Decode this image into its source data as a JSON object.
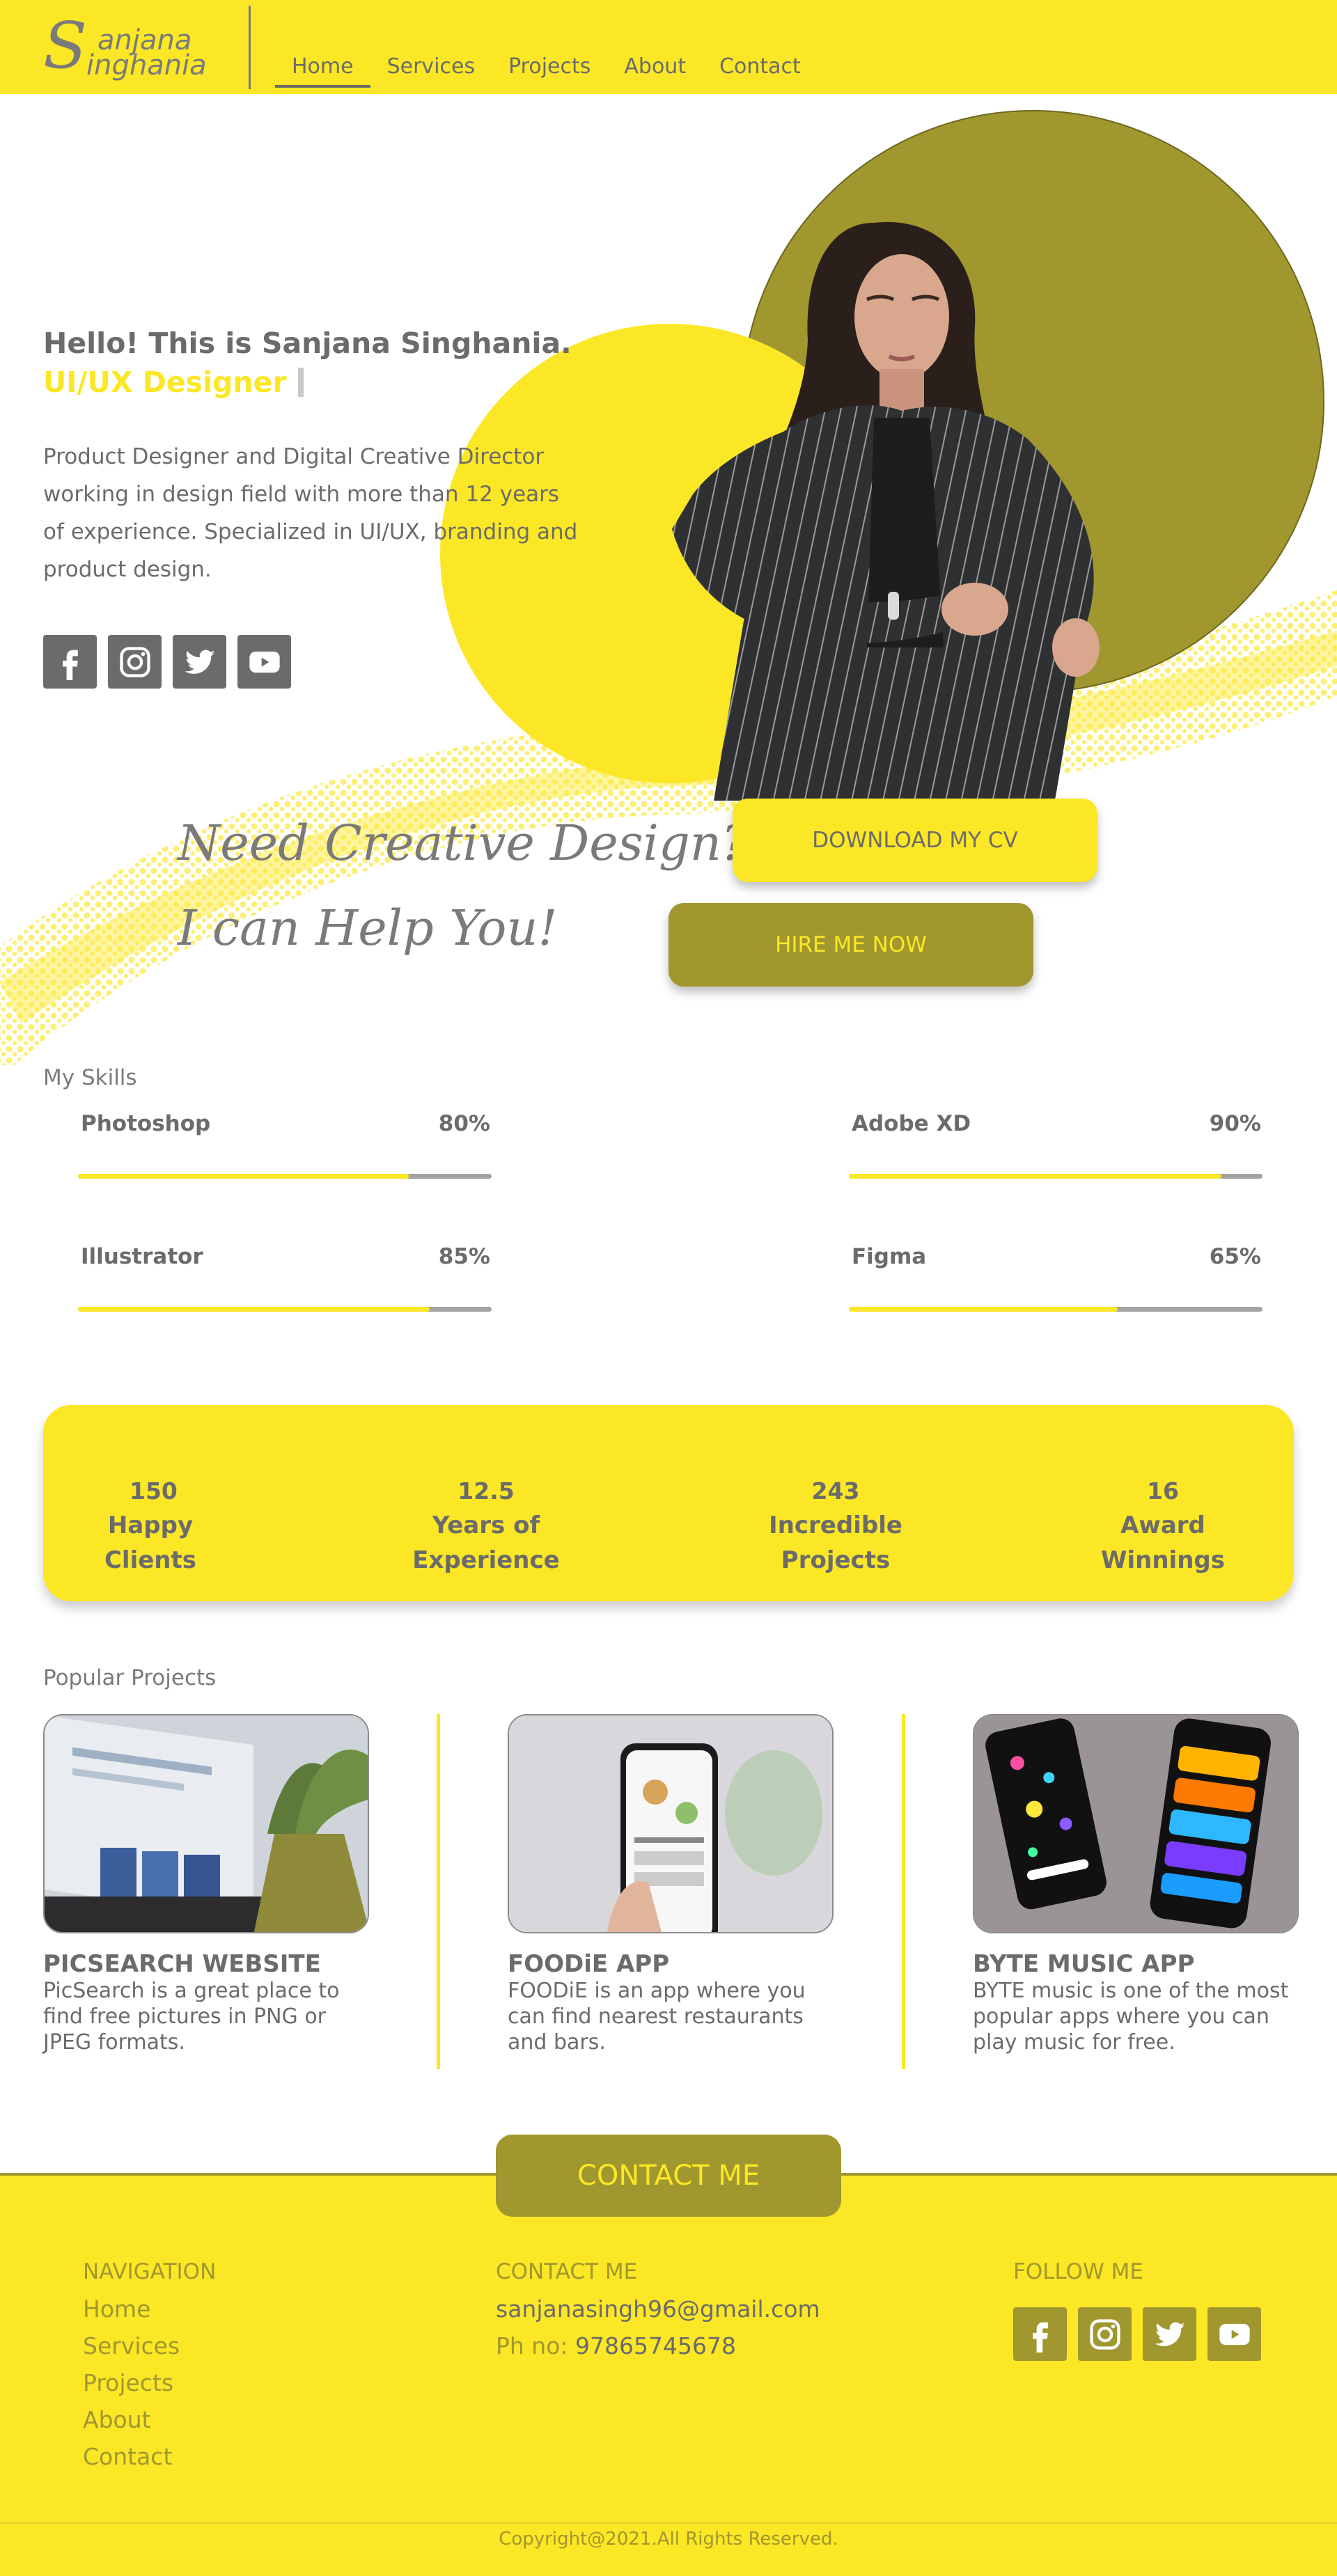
{
  "nav": {
    "logo_first": "anjana",
    "logo_second": "inghania",
    "logo_initial_top": "S",
    "logo_initial_bottom": "S",
    "links": [
      "Home",
      "Services",
      "Projects",
      "About",
      "Contact"
    ],
    "active": "Home"
  },
  "hero": {
    "greeting": "Hello! This is Sanjana Singhania.",
    "role": "UI/UX Designer",
    "bio": "Product Designer and Digital Creative Director working in design field with more than 12 years of experience. Specialized in UI/UX, branding and product design.",
    "social_icons": [
      "facebook-icon",
      "instagram-icon",
      "twitter-icon",
      "youtube-icon"
    ],
    "cta_line1": "Need Creative Design?",
    "cta_line2": "I can Help You!",
    "download_label": "DOWNLOAD MY CV",
    "hire_label": "HIRE ME NOW"
  },
  "skills": {
    "title": "My Skills",
    "items": [
      {
        "name": "Photoshop",
        "percent": "80%",
        "level": 0.8
      },
      {
        "name": "Adobe XD",
        "percent": "90%",
        "level": 0.9
      },
      {
        "name": "Illustrator",
        "percent": "85%",
        "level": 0.85
      },
      {
        "name": "Figma",
        "percent": "65%",
        "level": 0.65
      }
    ]
  },
  "stats": [
    {
      "value": "150",
      "label": "Happy Clients"
    },
    {
      "value": "12.5",
      "label": "Years of Experience"
    },
    {
      "value": "243",
      "label": "Incredible Projects"
    },
    {
      "value": "16",
      "label": "Award Winnings"
    }
  ],
  "projects": {
    "title": "Popular Projects",
    "items": [
      {
        "name": "PICSEARCH WEBSITE",
        "desc": "PicSearch is a great place to find free pictures in PNG or JPEG formats."
      },
      {
        "name": "FOODiE APP",
        "desc": "FOODiE is an app where you can find nearest restaurants and bars."
      },
      {
        "name": "BYTE MUSIC APP",
        "desc": "BYTE music is one of the most popular apps where you can play music for free."
      }
    ]
  },
  "footer": {
    "contact_button": "CONTACT ME",
    "nav_title": "NAVIGATION",
    "nav_links": [
      "Home",
      "Services",
      "Projects",
      "About",
      "Contact"
    ],
    "contact_title": "CONTACT ME",
    "email": "sanjanasingh96@gmail.com",
    "phone_label": "Ph no: ",
    "phone": "97865745678",
    "follow_title": "FOLLOW ME",
    "copyright": "Copyright@2021.All Rights Reserved."
  },
  "colors": {
    "accent": "#fbe725",
    "olive": "#a0972f",
    "text": "#6b6b6b"
  }
}
